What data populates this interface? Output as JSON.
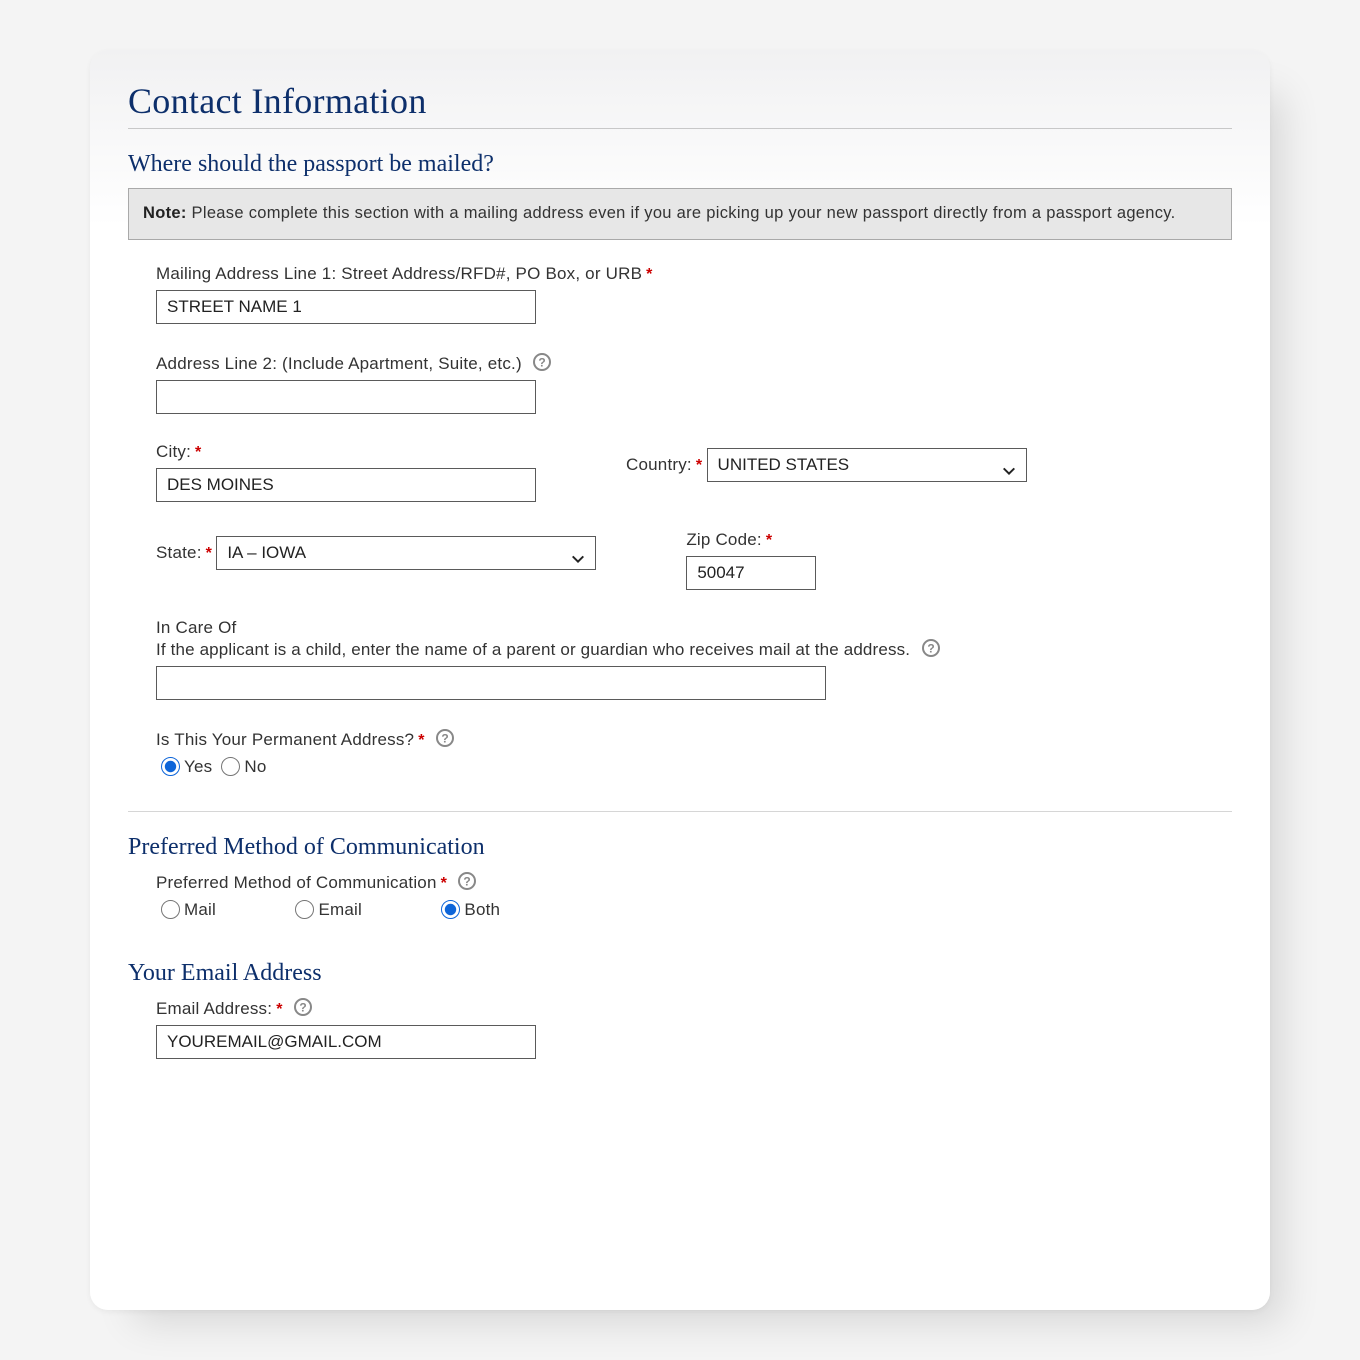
{
  "page_title": "Contact Information",
  "sections": {
    "mailing": {
      "title": "Where should the passport be mailed?",
      "note_prefix": "Note:",
      "note_body": " Please complete this section with a mailing address even if you are picking up your new passport directly from a passport agency.",
      "addr1_label": "Mailing Address Line 1: Street Address/RFD#, PO Box, or URB",
      "addr1_value": "STREET NAME 1",
      "addr2_label": "Address Line 2: (Include Apartment, Suite, etc.)",
      "addr2_value": "",
      "city_label": "City:",
      "city_value": "DES MOINES",
      "country_label": "Country:",
      "country_value": "UNITED STATES",
      "state_label": "State:",
      "state_value": "IA – IOWA",
      "zip_label": "Zip Code:",
      "zip_value": "50047",
      "care_label": "In Care Of",
      "care_help": "If the applicant is a child, enter the name of a parent or guardian who receives mail at the address.",
      "care_value": "",
      "perm_label": "Is This Your Permanent Address?",
      "perm_yes": "Yes",
      "perm_no": "No",
      "perm_value": "Yes"
    },
    "comm": {
      "title": "Preferred Method of Communication",
      "field_label": "Preferred Method of Communication",
      "opt_mail": "Mail",
      "opt_email": "Email",
      "opt_both": "Both",
      "selected": "Both"
    },
    "email": {
      "title": "Your Email Address",
      "label": "Email Address:",
      "value": "YOUREMAIL@GMAIL.COM"
    }
  }
}
